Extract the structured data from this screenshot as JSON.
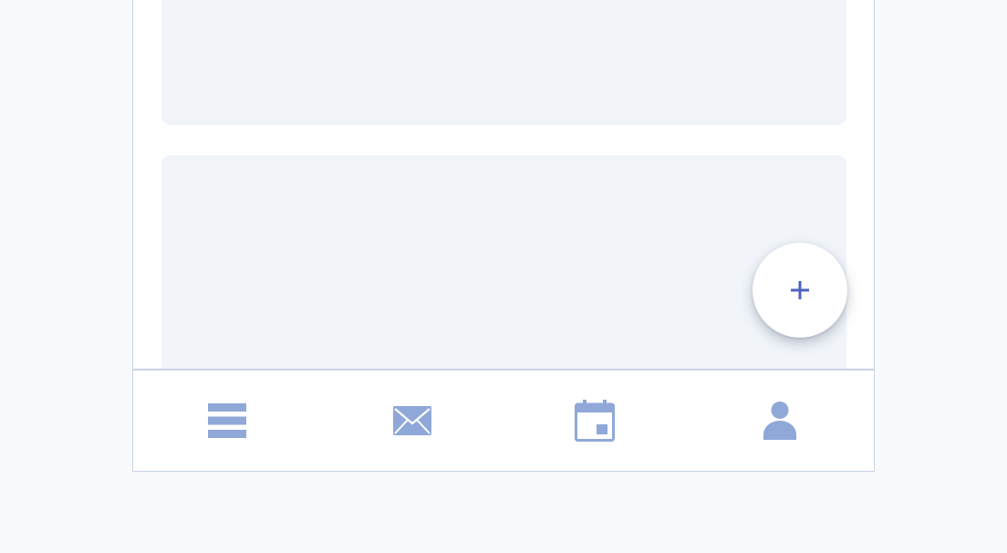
{
  "colors": {
    "page_background": "#f8f9fb",
    "frame_border": "#c9d3e8",
    "card_background": "#f1f5fa",
    "nav_icon": "#8fa8d8",
    "fab_plus": "#4d62c0"
  },
  "fab": {
    "label": "+",
    "icon": "plus-icon"
  },
  "bottom_nav": {
    "items": [
      {
        "id": "menu",
        "icon": "menu-icon"
      },
      {
        "id": "mail",
        "icon": "mail-icon"
      },
      {
        "id": "calendar",
        "icon": "calendar-icon"
      },
      {
        "id": "profile",
        "icon": "user-icon"
      }
    ]
  }
}
